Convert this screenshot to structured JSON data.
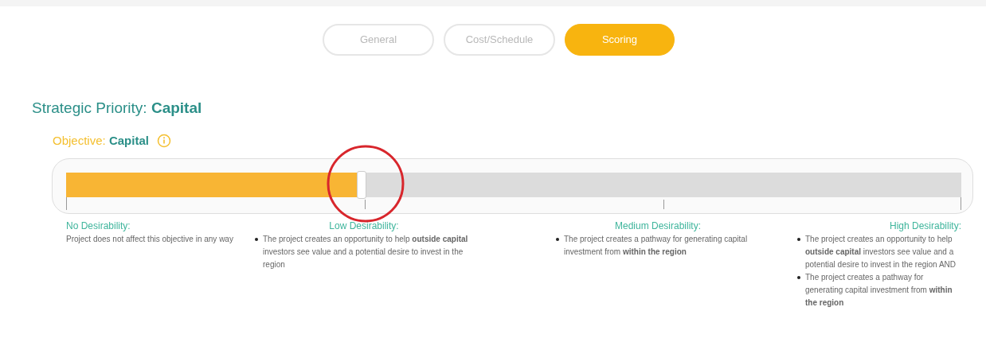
{
  "tabs": [
    {
      "label": "General",
      "selected": false
    },
    {
      "label": "Cost/Schedule",
      "selected": false
    },
    {
      "label": "Scoring",
      "selected": true
    }
  ],
  "strategic_priority": {
    "label": "Strategic Priority:",
    "value": "Capital"
  },
  "objective": {
    "label": "Objective:",
    "value": "Capital"
  },
  "slider": {
    "level": 0.33
  },
  "levels": [
    {
      "title": "No Desirability:",
      "kind": "paragraph",
      "text": "Project does not affect this objective in any way"
    },
    {
      "title": "Low Desirability:",
      "kind": "bullets",
      "bullets": [
        "The project creates an opportunity to help **outside capital** investors see value and a potential desire to invest in the region"
      ]
    },
    {
      "title": "Medium Desirability:",
      "kind": "bullets",
      "bullets": [
        "The project creates a pathway for generating capital investment from **within the region**"
      ]
    },
    {
      "title": "High Desirability:",
      "kind": "bullets",
      "bullets": [
        "The project creates an opportunity to help **outside capital** investors see value and a potential desire to invest in the region AND",
        "The project creates a pathway for generating capital investment from **within the region**"
      ]
    }
  ]
}
